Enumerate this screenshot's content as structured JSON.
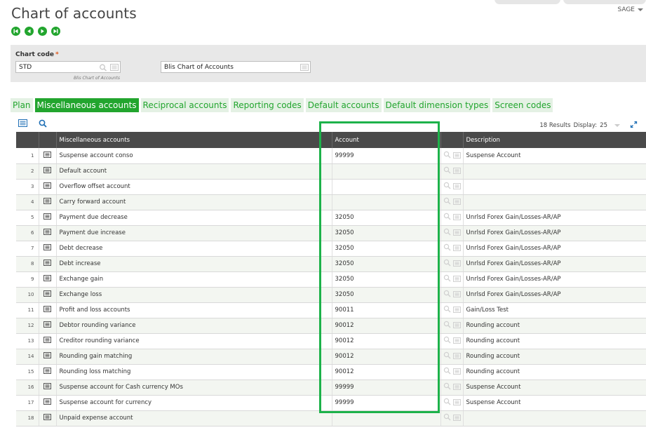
{
  "page": {
    "title": "Chart of accounts",
    "user": "SAGE"
  },
  "header": {
    "chart_code_label": "Chart code",
    "required_mark": "*",
    "chart_code_value": "STD",
    "chart_code_caption": "Blis Chart of Accounts",
    "description_value": "Blis Chart of Accounts"
  },
  "tabs": [
    {
      "label": "Plan"
    },
    {
      "label": "Miscellaneous accounts"
    },
    {
      "label": "Reciprocal accounts"
    },
    {
      "label": "Reporting codes"
    },
    {
      "label": "Default accounts"
    },
    {
      "label": "Default dimension types"
    },
    {
      "label": "Screen codes"
    }
  ],
  "grid": {
    "results_text": "18 Results",
    "display_label": "Display:",
    "display_value": "25",
    "columns": {
      "misc": "Miscellaneous accounts",
      "account": "Account",
      "description": "Description"
    },
    "rows": [
      {
        "n": "1",
        "name": "Suspense account conso",
        "account": "99999",
        "description": "Suspense Account"
      },
      {
        "n": "2",
        "name": "Default account",
        "account": "",
        "description": ""
      },
      {
        "n": "3",
        "name": "Overflow offset account",
        "account": "",
        "description": ""
      },
      {
        "n": "4",
        "name": "Carry forward account",
        "account": "",
        "description": ""
      },
      {
        "n": "5",
        "name": "Payment due decrease",
        "account": "32050",
        "description": "Unrlsd Forex Gain/Losses-AR/AP"
      },
      {
        "n": "6",
        "name": "Payment due increase",
        "account": "32050",
        "description": "Unrlsd Forex Gain/Losses-AR/AP"
      },
      {
        "n": "7",
        "name": "Debt decrease",
        "account": "32050",
        "description": "Unrlsd Forex Gain/Losses-AR/AP"
      },
      {
        "n": "8",
        "name": "Debt increase",
        "account": "32050",
        "description": "Unrlsd Forex Gain/Losses-AR/AP"
      },
      {
        "n": "9",
        "name": "Exchange gain",
        "account": "32050",
        "description": "Unrlsd Forex Gain/Losses-AR/AP"
      },
      {
        "n": "10",
        "name": "Exchange loss",
        "account": "32050",
        "description": "Unrlsd Forex Gain/Losses-AR/AP"
      },
      {
        "n": "11",
        "name": "Profit and loss accounts",
        "account": "90011",
        "description": "Gain/Loss Test"
      },
      {
        "n": "12",
        "name": "Debtor rounding variance",
        "account": "90012",
        "description": "Rounding account"
      },
      {
        "n": "13",
        "name": "Creditor rounding variance",
        "account": "90012",
        "description": "Rounding account"
      },
      {
        "n": "14",
        "name": "Rounding gain matching",
        "account": "90012",
        "description": "Rounding account"
      },
      {
        "n": "15",
        "name": "Rounding loss matching",
        "account": "90012",
        "description": "Rounding account"
      },
      {
        "n": "16",
        "name": "Suspense account for Cash currency MOs",
        "account": "99999",
        "description": "Suspense Account"
      },
      {
        "n": "17",
        "name": "Suspense account for currency",
        "account": "99999",
        "description": "Suspense Account"
      },
      {
        "n": "18",
        "name": "Unpaid expense account",
        "account": "",
        "description": ""
      }
    ]
  },
  "colors": {
    "accent": "#22a52e",
    "highlight": "#1db24a",
    "header_bg": "#4a4a4a"
  },
  "icons": {
    "first": "first-record-icon",
    "prev": "previous-record-icon",
    "next": "next-record-icon",
    "last": "last-record-icon",
    "search": "search-icon",
    "detail": "detail-card-icon",
    "expand": "expand-icon"
  }
}
